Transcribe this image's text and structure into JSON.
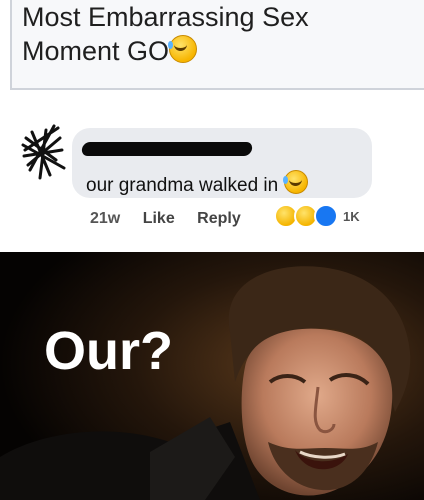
{
  "post": {
    "line1": "Most Embarrassing Sex",
    "line2": "Moment GO"
  },
  "comment": {
    "text": "our grandma walked in",
    "time": "21w",
    "like_label": "Like",
    "reply_label": "Reply",
    "reaction_count": "1K"
  },
  "meme": {
    "caption": "Our?"
  },
  "colors": {
    "bubble": "#e9ebef",
    "like_blue": "#1877f2",
    "meme_bg": "#000000"
  }
}
